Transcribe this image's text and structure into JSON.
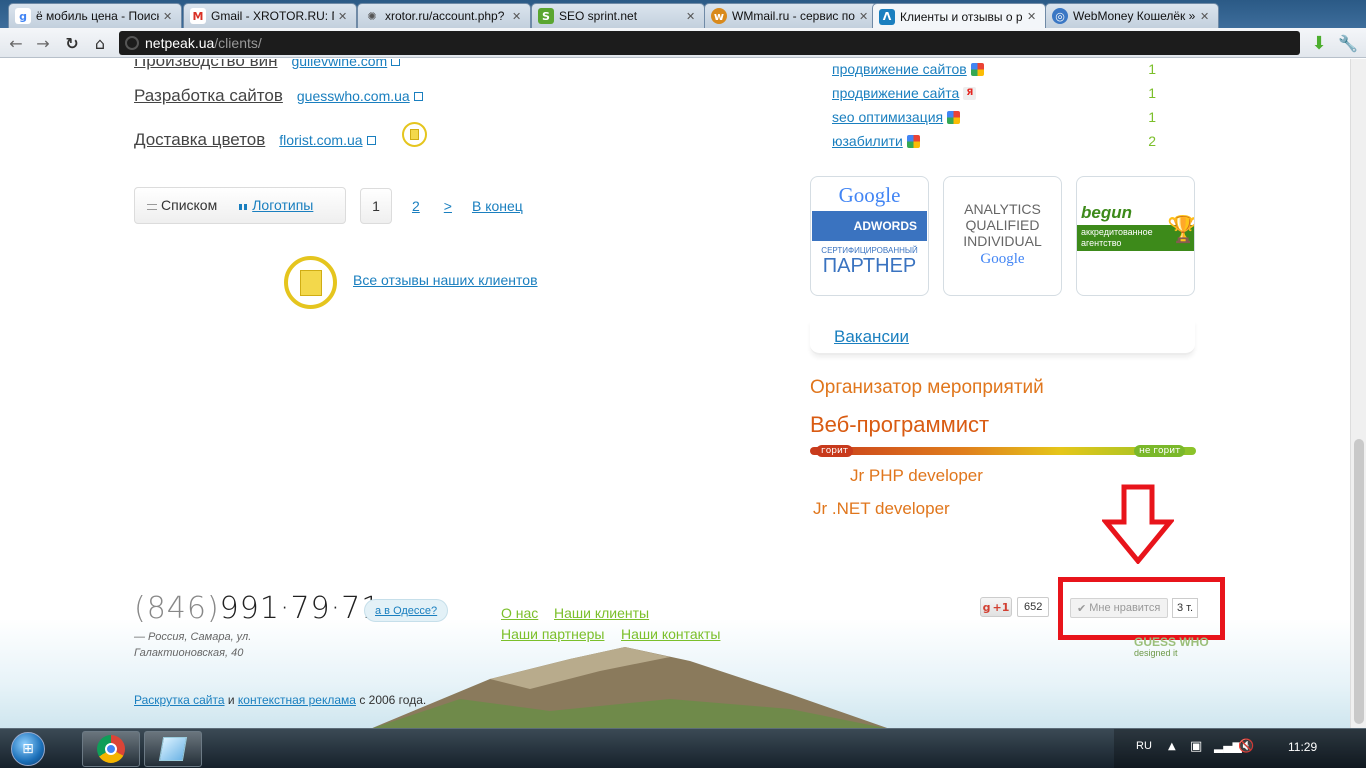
{
  "tabs": [
    {
      "label": "ё мобиль цена - Поиск",
      "icon": "google-icon",
      "color": "#4285f4"
    },
    {
      "label": "Gmail - XROTOR.RU: Пр",
      "icon": "gmail-icon",
      "color": "#d93025"
    },
    {
      "label": "xrotor.ru/account.php?",
      "icon": "spinner-icon",
      "color": "#555555"
    },
    {
      "label": "SEO sprint.net",
      "icon": "seosprint-icon",
      "color": "#5aa630"
    },
    {
      "label": "WMmail.ru - сервис по",
      "icon": "wmmail-icon",
      "color": "#d98a1c"
    },
    {
      "label": "Клиенты и отзывы о р",
      "icon": "netpeak-icon",
      "color": "#1a7fbf",
      "active": true
    },
    {
      "label": "WebMoney Кошелёк »",
      "icon": "webmoney-icon",
      "color": "#3a77c4"
    }
  ],
  "address": {
    "host": "netpeak.ua",
    "path": "/clients/"
  },
  "clients": [
    {
      "category": "Производство вин",
      "site": "gullevwine.com"
    },
    {
      "category": "Разработка сайтов",
      "site": "guesswho.com.ua"
    },
    {
      "category": "Доставка цветов",
      "site": "florist.com.ua"
    }
  ],
  "view_switch": {
    "list": "Списком",
    "logos": "Логотипы"
  },
  "pagination": {
    "current": "1",
    "page2": "2",
    "next": ">",
    "last": "В конец"
  },
  "all_reviews": "Все отзывы наших клиентов",
  "keywords": [
    {
      "text": "продвижение сайтов",
      "engine": "google",
      "count": "1"
    },
    {
      "text": "продвижение сайта",
      "engine": "yandex",
      "count": "1"
    },
    {
      "text": "seo оптимизация",
      "engine": "google",
      "count": "1"
    },
    {
      "text": "юзабилити",
      "engine": "google",
      "count": "2"
    }
  ],
  "certs": {
    "adwords": {
      "brand": "Google",
      "product": "ADWORDS",
      "line1": "СЕРТИФИЦИРОВАННЫЙ",
      "line2": "ПАРТНЕР"
    },
    "analytics": {
      "l1": "ANALYTICS",
      "l2": "QUALIFIED",
      "l3": "INDIVIDUAL",
      "brand": "Google"
    },
    "begun": {
      "brand": "begun",
      "l1": "аккредитованное",
      "l2": "агентство"
    }
  },
  "vacancies_title": "Вакансии",
  "jobs": [
    "Организатор мероприятий",
    "Веб-программист",
    "Jr PHP developer",
    "Jr .NET developer"
  ],
  "heat": {
    "hot": "горит",
    "not_hot": "не горит"
  },
  "footer": {
    "phone_code": "(846)",
    "phone_number": "991·79·71",
    "address_line1": "— Россия, Самара, ул.",
    "address_line2": "Галактионовская, 40",
    "odessa": "а в Одессе?",
    "links": {
      "about": "О нас",
      "clients": "Наши клиенты",
      "partners": "Наши партнеры",
      "contacts": "Наши контакты"
    },
    "gplus_label": "+1",
    "gplus_count": "652",
    "like_label": "Мне нравится",
    "like_count": "3 т.",
    "designer_l1": "GUESS WHO",
    "designer_l2": "designed it",
    "copy_link1": "Раскрутка сайта",
    "copy_and": "и",
    "copy_link2": "контекстная реклама",
    "copy_tail": "с 2006 года."
  },
  "taskbar": {
    "lang": "RU",
    "time": "11:29"
  },
  "colors": {
    "accent_blue": "#1a7fbf",
    "accent_green": "#7bbf2a",
    "job_orange": "#e0761c",
    "highlight_red": "#e8141b"
  }
}
